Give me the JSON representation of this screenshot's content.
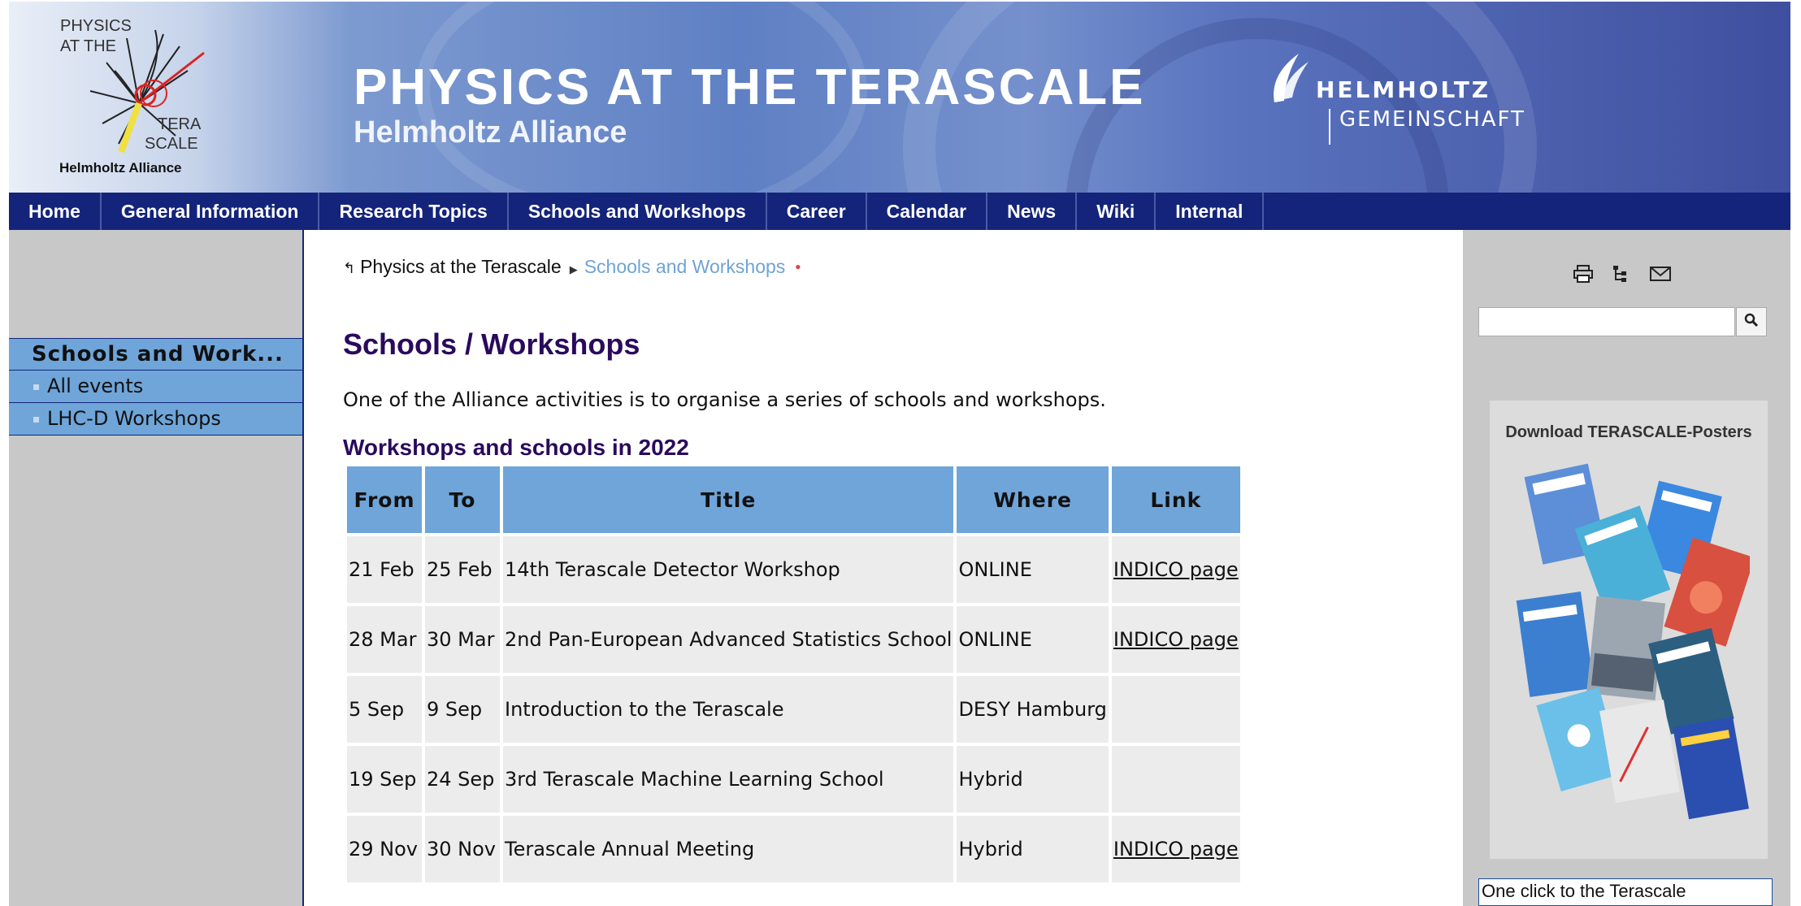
{
  "banner": {
    "logo_line1": "PHYSICS",
    "logo_line2": "AT THE",
    "logo_line3": "TERA",
    "logo_line4": "SCALE",
    "logo_line5": "Helmholtz Alliance",
    "title": "PHYSICS AT THE TERASCALE",
    "subtitle": "Helmholtz Alliance",
    "partner_line1": "HELMHOLTZ",
    "partner_line2": "GEMEINSCHAFT"
  },
  "nav": {
    "items": [
      "Home",
      "General Information",
      "Research Topics",
      "Schools and Workshops",
      "Career",
      "Calendar",
      "News",
      "Wiki",
      "Internal"
    ]
  },
  "sidebar": {
    "heading": "Schools and Work...",
    "items": [
      "All events",
      "LHC-D Workshops"
    ]
  },
  "breadcrumb": {
    "home": "Physics at the Terascale",
    "current": "Schools and Workshops"
  },
  "main": {
    "title": "Schools / Workshops",
    "intro": "One of the Alliance activities is to organise a series of schools and workshops.",
    "section_title": "Workshops and schools in 2022",
    "table": {
      "headers": [
        "From",
        "To",
        "Title",
        "Where",
        "Link"
      ],
      "rows": [
        [
          "21 Feb",
          "25 Feb",
          "14th Terascale Detector Workshop",
          "ONLINE",
          "INDICO page"
        ],
        [
          "28 Mar",
          "30 Mar",
          "2nd Pan-European Advanced Statistics School",
          "ONLINE",
          "INDICO page"
        ],
        [
          "5 Sep",
          "9 Sep",
          "Introduction to the Terascale",
          "DESY Hamburg",
          ""
        ],
        [
          "19 Sep",
          "24 Sep",
          "3rd Terascale Machine Learning School",
          "Hybrid",
          ""
        ],
        [
          "29 Nov",
          "30 Nov",
          "Terascale Annual Meeting",
          "Hybrid",
          "INDICO page"
        ]
      ]
    }
  },
  "right": {
    "icons": [
      "print-icon",
      "sitemap-icon",
      "mail-icon"
    ],
    "search_value": "",
    "poster_title": "Download TERASCALE-Posters",
    "one_click": "One click to the Terascale"
  },
  "colors": {
    "nav_bg": "#14247a",
    "accent_blue": "#6fa5d9",
    "title_purple": "#2a0a5c",
    "sidebar_gray": "#c8c8c8"
  }
}
